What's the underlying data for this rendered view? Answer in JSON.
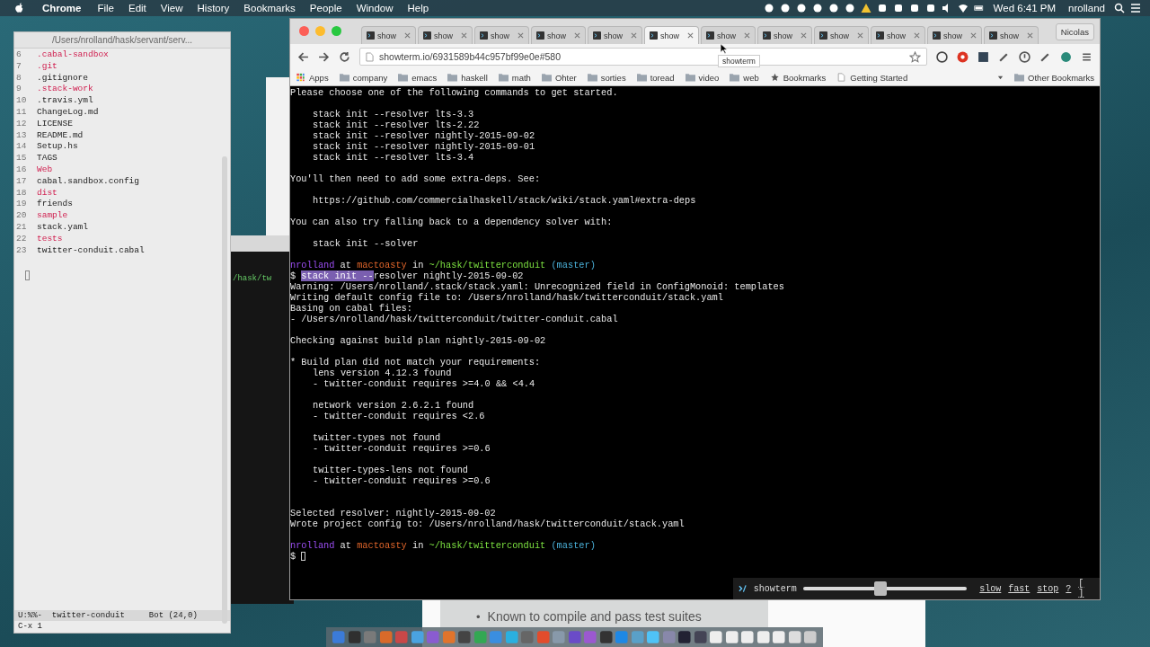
{
  "menubar": {
    "app": "Chrome",
    "menus": [
      "File",
      "Edit",
      "View",
      "History",
      "Bookmarks",
      "People",
      "Window",
      "Help"
    ],
    "clock": "Wed 6:41 PM",
    "user": "nrolland"
  },
  "editor": {
    "title": "/Users/nrolland/hask/servant/serv...",
    "lines": [
      {
        "number": "6",
        "name": ".cabal-sandbox",
        "kind": "dir"
      },
      {
        "number": "7",
        "name": ".git",
        "kind": "dir"
      },
      {
        "number": "8",
        "name": ".gitignore",
        "kind": "file"
      },
      {
        "number": "9",
        "name": ".stack-work",
        "kind": "dir"
      },
      {
        "number": "10",
        "name": ".travis.yml",
        "kind": "file"
      },
      {
        "number": "11",
        "name": "ChangeLog.md",
        "kind": "file"
      },
      {
        "number": "12",
        "name": "LICENSE",
        "kind": "file"
      },
      {
        "number": "13",
        "name": "README.md",
        "kind": "file"
      },
      {
        "number": "14",
        "name": "Setup.hs",
        "kind": "file"
      },
      {
        "number": "15",
        "name": "TAGS",
        "kind": "file"
      },
      {
        "number": "16",
        "name": "Web",
        "kind": "dir"
      },
      {
        "number": "17",
        "name": "cabal.sandbox.config",
        "kind": "file"
      },
      {
        "number": "18",
        "name": "dist",
        "kind": "dir"
      },
      {
        "number": "19",
        "name": "friends",
        "kind": "file"
      },
      {
        "number": "20",
        "name": "sample",
        "kind": "dir"
      },
      {
        "number": "21",
        "name": "stack.yaml",
        "kind": "file"
      },
      {
        "number": "22",
        "name": "tests",
        "kind": "dir"
      },
      {
        "number": "23",
        "name": "twitter-conduit.cabal",
        "kind": "file"
      }
    ],
    "mode_line": "U:%%-  twitter-conduit     Bot (24,0)",
    "minibuffer": "C-x 1"
  },
  "background_terminal": {
    "text": "/hask/tw"
  },
  "slide": {
    "bullet": "•",
    "text": "Known to compile and pass test suites"
  },
  "browser": {
    "tabs": [
      {
        "label": "show",
        "selected": false
      },
      {
        "label": "show",
        "selected": false
      },
      {
        "label": "show",
        "selected": false
      },
      {
        "label": "show",
        "selected": false
      },
      {
        "label": "show",
        "selected": false
      },
      {
        "label": "show",
        "selected": true
      },
      {
        "label": "show",
        "selected": false
      },
      {
        "label": "show",
        "selected": false
      },
      {
        "label": "show",
        "selected": false
      },
      {
        "label": "show",
        "selected": false
      },
      {
        "label": "show",
        "selected": false
      },
      {
        "label": "show",
        "selected": false
      }
    ],
    "tooltip": "showterm",
    "profile": "Nicolas",
    "address": "showterm.io/6931589b44c957bf99e0e#580",
    "bookmarks": [
      {
        "label": "Apps",
        "kind": "apps"
      },
      {
        "label": "company",
        "kind": "folder"
      },
      {
        "label": "emacs",
        "kind": "folder"
      },
      {
        "label": "haskell",
        "kind": "folder"
      },
      {
        "label": "math",
        "kind": "folder"
      },
      {
        "label": "Ohter",
        "kind": "folder"
      },
      {
        "label": "sorties",
        "kind": "folder"
      },
      {
        "label": "toread",
        "kind": "folder"
      },
      {
        "label": "video",
        "kind": "folder"
      },
      {
        "label": "web",
        "kind": "folder"
      },
      {
        "label": "Bookmarks",
        "kind": "star"
      },
      {
        "label": "Getting Started",
        "kind": "page"
      }
    ],
    "other_bookmarks": "Other Bookmarks"
  },
  "terminal": {
    "lines": [
      {
        "kind": "text",
        "segments": [
          {
            "text": "Please choose one of the following commands to get started.",
            "kind": "plain"
          }
        ]
      },
      {
        "kind": "blank"
      },
      {
        "kind": "text",
        "indent": true,
        "segments": [
          {
            "text": "stack init --resolver lts-3.3",
            "kind": "plain"
          }
        ]
      },
      {
        "kind": "text",
        "indent": true,
        "segments": [
          {
            "text": "stack init --resolver lts-2.22",
            "kind": "plain"
          }
        ]
      },
      {
        "kind": "text",
        "indent": true,
        "segments": [
          {
            "text": "stack init --resolver nightly-2015-09-02",
            "kind": "plain"
          }
        ]
      },
      {
        "kind": "text",
        "indent": true,
        "segments": [
          {
            "text": "stack init --resolver nightly-2015-09-01",
            "kind": "plain"
          }
        ]
      },
      {
        "kind": "text",
        "indent": true,
        "segments": [
          {
            "text": "stack init --resolver lts-3.4",
            "kind": "plain"
          }
        ]
      },
      {
        "kind": "blank"
      },
      {
        "kind": "text",
        "segments": [
          {
            "text": "You'll then need to add some extra-deps. See:",
            "kind": "plain"
          }
        ]
      },
      {
        "kind": "blank"
      },
      {
        "kind": "text",
        "indent": true,
        "segments": [
          {
            "text": "https://github.com/commercialhaskell/stack/wiki/stack.yaml#extra-deps",
            "kind": "plain"
          }
        ]
      },
      {
        "kind": "blank"
      },
      {
        "kind": "text",
        "segments": [
          {
            "text": "You can also try falling back to a dependency solver with:",
            "kind": "plain"
          }
        ]
      },
      {
        "kind": "blank"
      },
      {
        "kind": "text",
        "indent": true,
        "segments": [
          {
            "text": "stack init --solver",
            "kind": "plain"
          }
        ]
      },
      {
        "kind": "blank"
      },
      {
        "kind": "text",
        "segments": [
          {
            "text": "nrolland",
            "kind": "user"
          },
          {
            "text": " at ",
            "kind": "plain"
          },
          {
            "text": "mactoasty",
            "kind": "host"
          },
          {
            "text": " in ",
            "kind": "plain"
          },
          {
            "text": "~/hask/twitterconduit",
            "kind": "path"
          },
          {
            "text": " (master)",
            "kind": "branch"
          }
        ]
      },
      {
        "kind": "text",
        "segments": [
          {
            "text": "$ ",
            "kind": "plain"
          },
          {
            "text": "stack init --",
            "kind": "selected"
          },
          {
            "text": "resolver nightly-2015-09-02",
            "kind": "plain"
          }
        ]
      },
      {
        "kind": "text",
        "segments": [
          {
            "text": "Warning: /Users/nrolland/.stack/stack.yaml: Unrecognized field in ConfigMonoid: templates",
            "kind": "plain"
          }
        ]
      },
      {
        "kind": "text",
        "segments": [
          {
            "text": "Writing default config file to: /Users/nrolland/hask/twitterconduit/stack.yaml",
            "kind": "plain"
          }
        ]
      },
      {
        "kind": "text",
        "segments": [
          {
            "text": "Basing on cabal files:",
            "kind": "plain"
          }
        ]
      },
      {
        "kind": "text",
        "segments": [
          {
            "text": "- /Users/nrolland/hask/twitterconduit/twitter-conduit.cabal",
            "kind": "plain"
          }
        ]
      },
      {
        "kind": "blank"
      },
      {
        "kind": "text",
        "segments": [
          {
            "text": "Checking against build plan nightly-2015-09-02",
            "kind": "plain"
          }
        ]
      },
      {
        "kind": "blank"
      },
      {
        "kind": "text",
        "segments": [
          {
            "text": "* Build plan did not match your requirements:",
            "kind": "plain"
          }
        ]
      },
      {
        "kind": "text",
        "indent": true,
        "segments": [
          {
            "text": "lens version 4.12.3 found",
            "kind": "plain"
          }
        ]
      },
      {
        "kind": "text",
        "indent": true,
        "segments": [
          {
            "text": "- twitter-conduit requires >=4.0 && <4.4",
            "kind": "plain"
          }
        ]
      },
      {
        "kind": "blank"
      },
      {
        "kind": "text",
        "indent": true,
        "segments": [
          {
            "text": "network version 2.6.2.1 found",
            "kind": "plain"
          }
        ]
      },
      {
        "kind": "text",
        "indent": true,
        "segments": [
          {
            "text": "- twitter-conduit requires <2.6",
            "kind": "plain"
          }
        ]
      },
      {
        "kind": "blank"
      },
      {
        "kind": "text",
        "indent": true,
        "segments": [
          {
            "text": "twitter-types not found",
            "kind": "plain"
          }
        ]
      },
      {
        "kind": "text",
        "indent": true,
        "segments": [
          {
            "text": "- twitter-conduit requires >=0.6",
            "kind": "plain"
          }
        ]
      },
      {
        "kind": "blank"
      },
      {
        "kind": "text",
        "indent": true,
        "segments": [
          {
            "text": "twitter-types-lens not found",
            "kind": "plain"
          }
        ]
      },
      {
        "kind": "text",
        "indent": true,
        "segments": [
          {
            "text": "- twitter-conduit requires >=0.6",
            "kind": "plain"
          }
        ]
      },
      {
        "kind": "blank"
      },
      {
        "kind": "blank"
      },
      {
        "kind": "text",
        "segments": [
          {
            "text": "Selected resolver: nightly-2015-09-02",
            "kind": "plain"
          }
        ]
      },
      {
        "kind": "text",
        "segments": [
          {
            "text": "Wrote project config to: /Users/nrolland/hask/twitterconduit/stack.yaml",
            "kind": "plain"
          }
        ]
      },
      {
        "kind": "blank"
      },
      {
        "kind": "text",
        "segments": [
          {
            "text": "nrolland",
            "kind": "user"
          },
          {
            "text": " at ",
            "kind": "plain"
          },
          {
            "text": "mactoasty",
            "kind": "host"
          },
          {
            "text": " in ",
            "kind": "plain"
          },
          {
            "text": "~/hask/twitterconduit",
            "kind": "path"
          },
          {
            "text": " (master)",
            "kind": "branch"
          }
        ]
      },
      {
        "kind": "cursor",
        "segments": [
          {
            "text": "$ ",
            "kind": "plain"
          }
        ]
      }
    ]
  },
  "player": {
    "title": "showterm",
    "level": 0.47,
    "links": [
      "slow",
      "fast",
      "stop",
      "?",
      "[ ]"
    ]
  }
}
